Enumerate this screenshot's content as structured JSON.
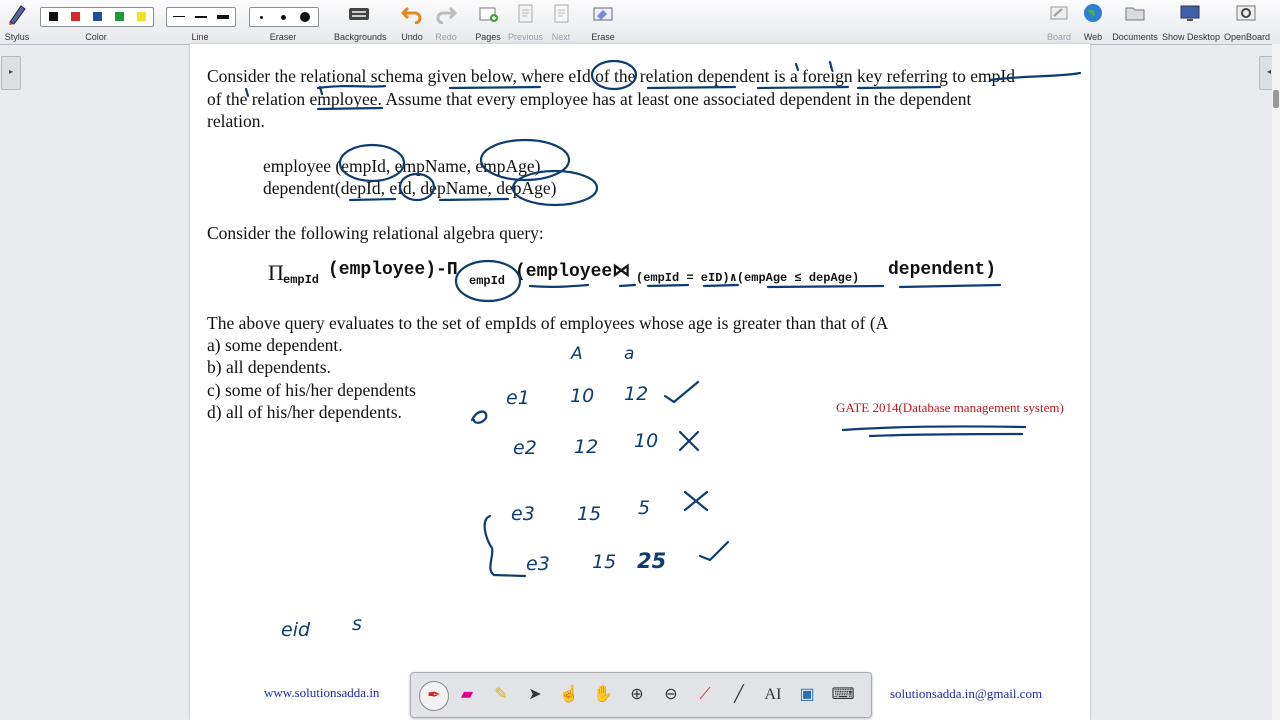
{
  "toolbar": {
    "stylus": "Stylus",
    "color": "Color",
    "line": "Line",
    "eraser": "Eraser",
    "backgrounds": "Backgrounds",
    "undo": "Undo",
    "redo": "Redo",
    "pages": "Pages",
    "previous": "Previous",
    "next": "Next",
    "erase": "Erase",
    "board": "Board",
    "web": "Web",
    "documents": "Documents",
    "show_desktop": "Show Desktop",
    "openboard": "OpenBoard",
    "colors": [
      "#111111",
      "#d42a2a",
      "#1f4e9a",
      "#1e9b3b",
      "#f3e221"
    ]
  },
  "content": {
    "intro_1": "Consider the relational schema given below, where eId of the relation dependent is a foreign key referring to empId",
    "intro_2": "of the relation employee. Assume that every employee has at least one associated dependent in the dependent",
    "intro_3": "relation.",
    "schema_1": "employee (empId, empName, empAge)",
    "schema_2": "dependent(depId, eId, depName, depAge)",
    "query_intro": "Consider the following relational algebra query:",
    "q_pi1": "Π",
    "q_sub1": "empId",
    "q_part1": "(employee)-Π",
    "q_sub2": "empId",
    "q_part2": "(employee⋈",
    "q_cond": "(empId = eID)∧(empAge ≤ depAge)",
    "q_part3": "dependent)",
    "question": "The above query evaluates to the set of empIds of employees whose age is greater than that of (A",
    "opt_a": "a) some dependent.",
    "opt_b": "b) all dependents.",
    "opt_c": "c) some of his/her dependents",
    "opt_d": "d) all of his/her dependents.",
    "gate_label": "GATE 2014(Database management system)",
    "website": "www.solutionsadda.in",
    "email": "solutionsadda.in@gmail.com"
  },
  "handwriting": {
    "col_A": "A",
    "col_a": "a",
    "r1": [
      "e1",
      "10",
      "12",
      "✓"
    ],
    "r2": [
      "e2",
      "12",
      "10",
      "✗"
    ],
    "r3": [
      "e3",
      "15",
      "5",
      "✗"
    ],
    "r4": [
      "e3",
      "15",
      "25",
      "✓"
    ],
    "bottom_1": "eid",
    "bottom_2": "s"
  },
  "icons": {
    "stylus": "stylus-icon",
    "backgrounds": "keyboard-icon",
    "undo": "undo-icon",
    "redo": "redo-icon",
    "pages": "pages-icon",
    "previous": "previous-page-icon",
    "next": "next-page-icon",
    "erase": "erase-icon",
    "board": "board-icon",
    "web": "globe-icon",
    "documents": "folder-icon",
    "show_desktop": "monitor-icon",
    "openboard": "gear-icon"
  }
}
